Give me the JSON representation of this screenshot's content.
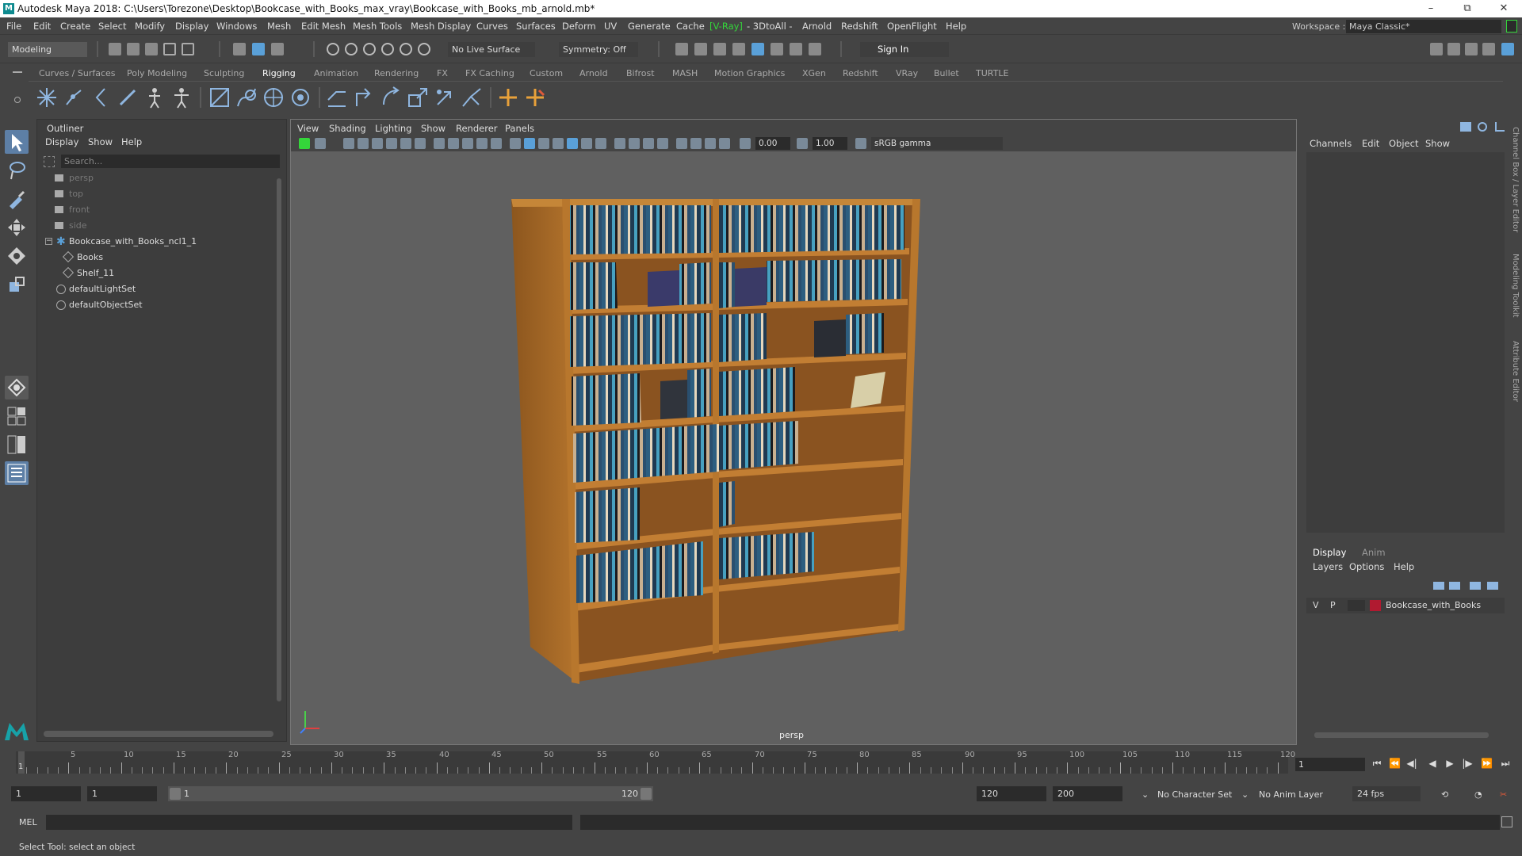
{
  "window": {
    "title": "Autodesk Maya 2018: C:\\Users\\Torezone\\Desktop\\Bookcase_with_Books_max_vray\\Bookcase_with_Books_mb_arnold.mb*"
  },
  "menubar": {
    "items": [
      "File",
      "Edit",
      "Create",
      "Select",
      "Modify",
      "Display",
      "Windows",
      "Mesh",
      "Edit Mesh",
      "Mesh Tools",
      "Mesh Display",
      "Curves",
      "Surfaces",
      "Deform",
      "UV",
      "Generate",
      "Cache",
      "[V-Ray]",
      "- 3DtoAll -",
      "Arnold",
      "Redshift",
      "OpenFlight",
      "Help"
    ],
    "workspace_label": "Workspace :",
    "workspace_value": "Maya Classic*"
  },
  "statusline": {
    "mode": "Modeling",
    "live_surface": "No Live Surface",
    "symmetry": "Symmetry: Off",
    "sign_in": "Sign In"
  },
  "shelf": {
    "tabs": [
      "Curves / Surfaces",
      "Poly Modeling",
      "Sculpting",
      "Rigging",
      "Animation",
      "Rendering",
      "FX",
      "FX Caching",
      "Custom",
      "Arnold",
      "Bifrost",
      "MASH",
      "Motion Graphics",
      "XGen",
      "Redshift",
      "VRay",
      "Bullet",
      "TURTLE"
    ],
    "active_tab": "Rigging"
  },
  "outliner": {
    "title": "Outliner",
    "menu": [
      "Display",
      "Show",
      "Help"
    ],
    "search_placeholder": "Search...",
    "items": [
      {
        "label": "persp",
        "type": "camera",
        "dim": true
      },
      {
        "label": "top",
        "type": "camera",
        "dim": true
      },
      {
        "label": "front",
        "type": "camera",
        "dim": true
      },
      {
        "label": "side",
        "type": "camera",
        "dim": true
      },
      {
        "label": "Bookcase_with_Books_ncl1_1",
        "type": "group",
        "dim": false
      },
      {
        "label": "Books",
        "type": "mesh",
        "dim": false
      },
      {
        "label": "Shelf_11",
        "type": "mesh",
        "dim": false
      },
      {
        "label": "defaultLightSet",
        "type": "set",
        "dim": false
      },
      {
        "label": "defaultObjectSet",
        "type": "set",
        "dim": false
      }
    ]
  },
  "viewport": {
    "menu": [
      "View",
      "Shading",
      "Lighting",
      "Show",
      "Renderer",
      "Panels"
    ],
    "exposure": "0.00",
    "gamma": "1.00",
    "color_space": "sRGB gamma",
    "camera_label": "persp"
  },
  "channelbox": {
    "menu": [
      "Channels",
      "Edit",
      "Object",
      "Show"
    ],
    "side_tabs": [
      "Channel Box / Layer Editor",
      "Modeling Toolkit",
      "Attribute Editor"
    ]
  },
  "layereditor": {
    "tabs": [
      "Display",
      "Anim"
    ],
    "active_tab": "Display",
    "menu": [
      "Layers",
      "Options",
      "Help"
    ],
    "layer": {
      "visible": "V",
      "playback": "P",
      "name": "Bookcase_with_Books",
      "color": "#b01a30"
    }
  },
  "timeslider": {
    "labels": [
      "5",
      "10",
      "15",
      "20",
      "25",
      "30",
      "35",
      "40",
      "45",
      "50",
      "55",
      "60",
      "65",
      "70",
      "75",
      "80",
      "85",
      "90",
      "95",
      "100",
      "105",
      "110",
      "115",
      "120"
    ],
    "current_frame": "1",
    "current_frame_field": "1"
  },
  "rangeslider": {
    "start_field": "1",
    "anim_start_field": "1",
    "range_start": "1",
    "range_end": "120",
    "anim_end_field": "120",
    "end_field": "200",
    "character_set": "No Character Set",
    "anim_layer": "No Anim Layer",
    "fps": "24 fps"
  },
  "cmdline": {
    "label": "MEL"
  },
  "helpline": {
    "text": "Select Tool: select an object"
  }
}
